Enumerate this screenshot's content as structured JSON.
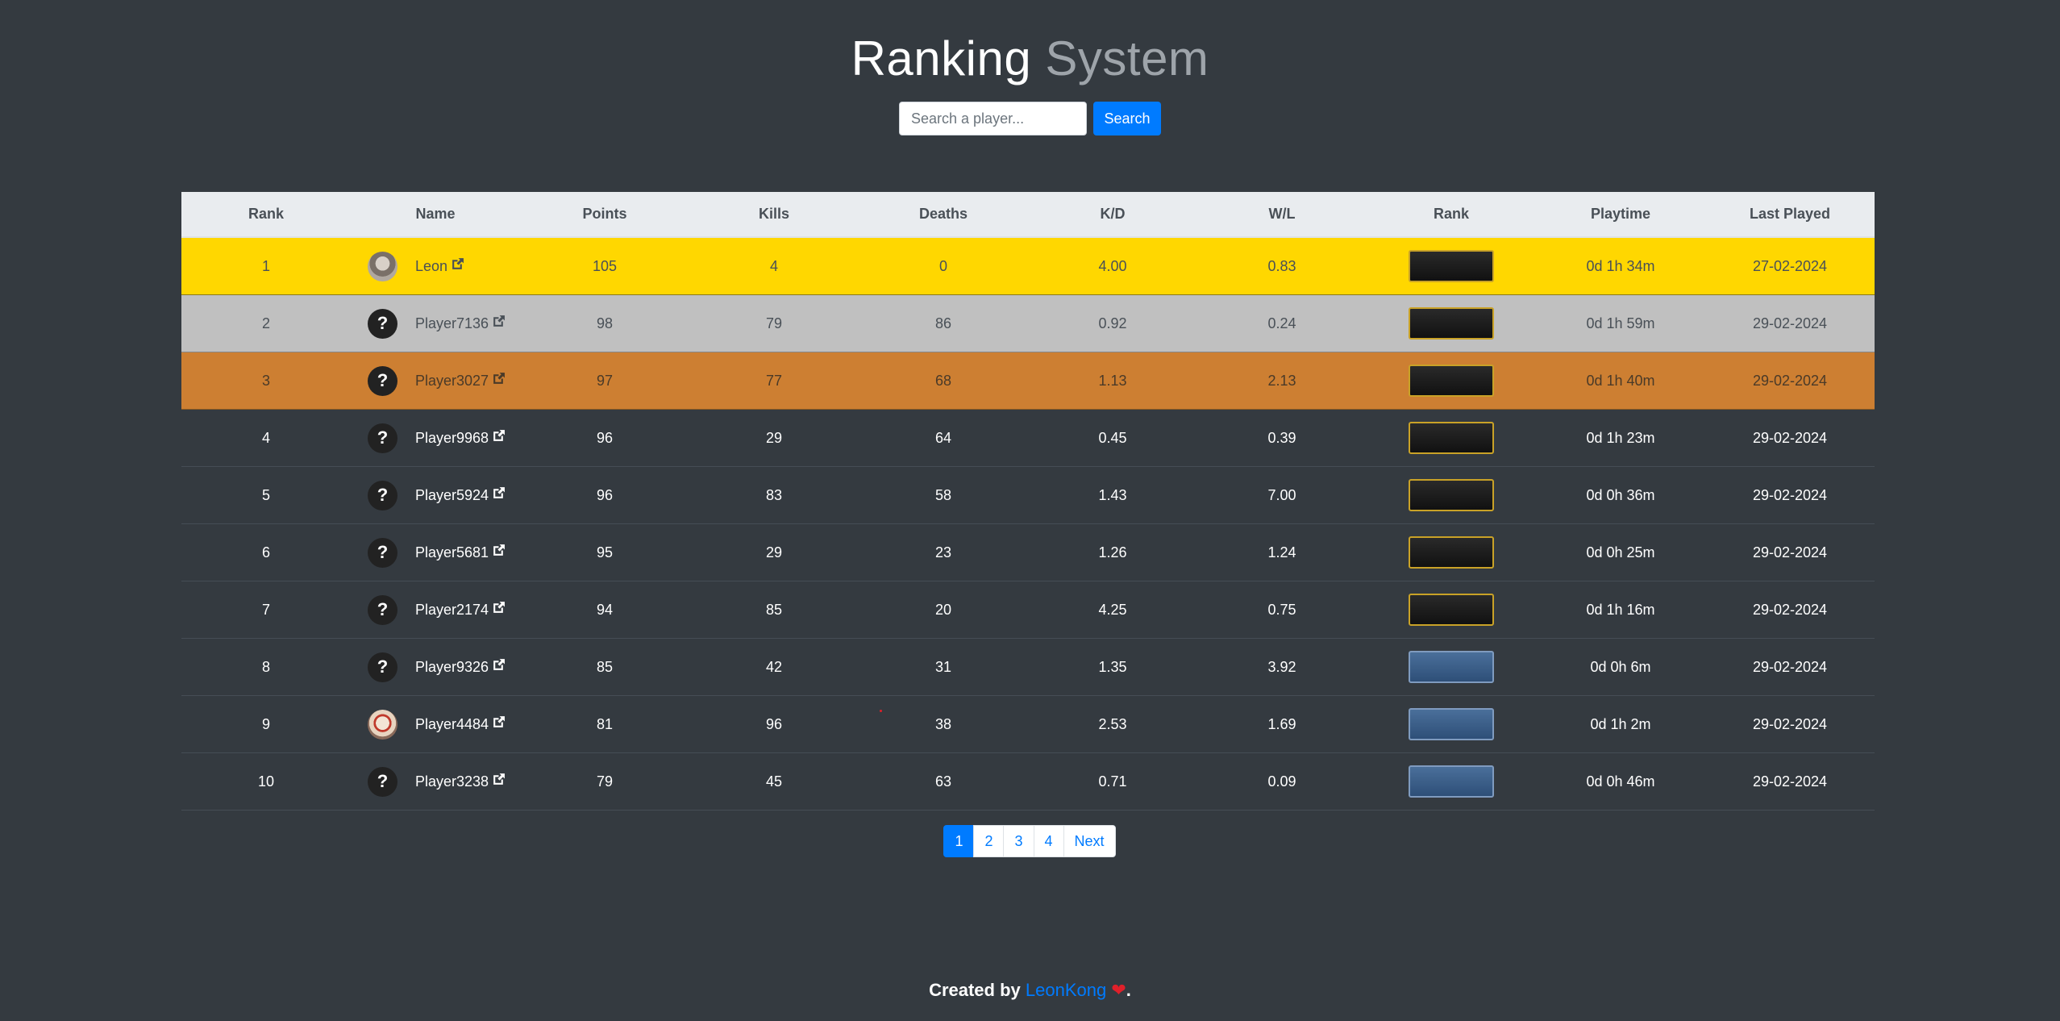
{
  "header": {
    "title_word1": "Ranking",
    "title_word2": "System"
  },
  "search": {
    "placeholder": "Search a player...",
    "button_label": "Search"
  },
  "table": {
    "columns": [
      "Rank",
      "Name",
      "Points",
      "Kills",
      "Deaths",
      "K/D",
      "W/L",
      "Rank",
      "Playtime",
      "Last Played"
    ],
    "rows": [
      {
        "rank": "1",
        "name": "Leon",
        "points": "105",
        "kills": "4",
        "deaths": "0",
        "kd": "4.00",
        "wl": "0.83",
        "playtime": "0d 1h 34m",
        "last_played": "27-02-2024"
      },
      {
        "rank": "2",
        "name": "Player7136",
        "points": "98",
        "kills": "79",
        "deaths": "86",
        "kd": "0.92",
        "wl": "0.24",
        "playtime": "0d 1h 59m",
        "last_played": "29-02-2024"
      },
      {
        "rank": "3",
        "name": "Player3027",
        "points": "97",
        "kills": "77",
        "deaths": "68",
        "kd": "1.13",
        "wl": "2.13",
        "playtime": "0d 1h 40m",
        "last_played": "29-02-2024"
      },
      {
        "rank": "4",
        "name": "Player9968",
        "points": "96",
        "kills": "29",
        "deaths": "64",
        "kd": "0.45",
        "wl": "0.39",
        "playtime": "0d 1h 23m",
        "last_played": "29-02-2024"
      },
      {
        "rank": "5",
        "name": "Player5924",
        "points": "96",
        "kills": "83",
        "deaths": "58",
        "kd": "1.43",
        "wl": "7.00",
        "playtime": "0d 0h 36m",
        "last_played": "29-02-2024"
      },
      {
        "rank": "6",
        "name": "Player5681",
        "points": "95",
        "kills": "29",
        "deaths": "23",
        "kd": "1.26",
        "wl": "1.24",
        "playtime": "0d 0h 25m",
        "last_played": "29-02-2024"
      },
      {
        "rank": "7",
        "name": "Player2174",
        "points": "94",
        "kills": "85",
        "deaths": "20",
        "kd": "4.25",
        "wl": "0.75",
        "playtime": "0d 1h 16m",
        "last_played": "29-02-2024"
      },
      {
        "rank": "8",
        "name": "Player9326",
        "points": "85",
        "kills": "42",
        "deaths": "31",
        "kd": "1.35",
        "wl": "3.92",
        "playtime": "0d 0h 6m",
        "last_played": "29-02-2024"
      },
      {
        "rank": "9",
        "name": "Player4484",
        "points": "81",
        "kills": "96",
        "deaths": "38",
        "kd": "2.53",
        "wl": "1.69",
        "playtime": "0d 1h 2m",
        "last_played": "29-02-2024"
      },
      {
        "rank": "10",
        "name": "Player3238",
        "points": "79",
        "kills": "45",
        "deaths": "63",
        "kd": "0.71",
        "wl": "0.09",
        "playtime": "0d 0h 46m",
        "last_played": "29-02-2024"
      }
    ]
  },
  "pagination": {
    "pages": [
      "1",
      "2",
      "3",
      "4"
    ],
    "active": "1",
    "next_label": "Next"
  },
  "footer": {
    "prefix": "Created by",
    "author": "LeonKong",
    "suffix": "."
  },
  "colors": {
    "background": "#343a40",
    "accent": "#007bff",
    "gold": "#ffd700",
    "silver": "#c0c0c0",
    "bronze": "#cd7f32"
  }
}
